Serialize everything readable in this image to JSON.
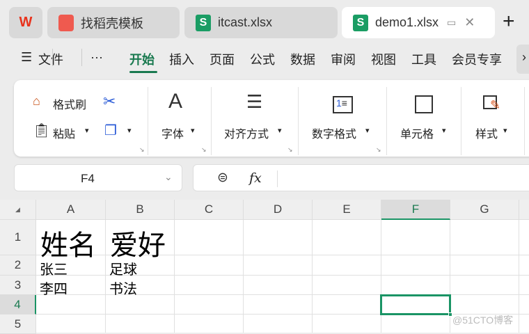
{
  "tabs": [
    {
      "label": "找稻壳模板"
    },
    {
      "label": "itcast.xlsx"
    },
    {
      "label": "demo1.xlsx"
    }
  ],
  "menu": {
    "file": "文件",
    "more": "···",
    "items": [
      "开始",
      "插入",
      "页面",
      "公式",
      "数据",
      "审阅",
      "视图",
      "工具",
      "会员专享"
    ]
  },
  "ribbon": {
    "format_painter": "格式刷",
    "paste": "粘贴",
    "font": "字体",
    "align": "对齐方式",
    "number": "数字格式",
    "cell": "单元格",
    "style": "样式"
  },
  "name_box": "F4",
  "formula": {
    "fx": "fx",
    "value": ""
  },
  "columns": [
    "A",
    "B",
    "C",
    "D",
    "E",
    "F",
    "G"
  ],
  "rows": [
    "1",
    "2",
    "3",
    "4",
    "5"
  ],
  "cells": {
    "A1": "姓名",
    "B1": "爱好",
    "A2": "张三",
    "B2": "足球",
    "A3": "李四",
    "B3": "书法"
  },
  "active_cell": "F4",
  "accent": "#1a9465",
  "watermark": "@51CTO博客"
}
